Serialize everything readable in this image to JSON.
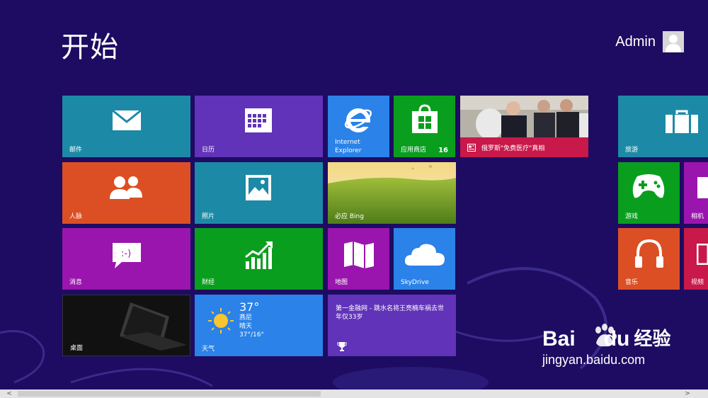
{
  "header": {
    "title": "开始",
    "user_name": "Admin"
  },
  "tiles": {
    "mail": "邮件",
    "calendar": "日历",
    "ie_line1": "Internet",
    "ie_line2": "Explorer",
    "store": "应用商店",
    "store_badge": "16",
    "news": "俄罗斯\"免费医疗\"真相",
    "travel": "旅游",
    "people": "人脉",
    "photos": "照片",
    "bing": "必应 Bing",
    "games": "游戏",
    "camera": "相机",
    "messaging": "消息",
    "finance": "财经",
    "maps": "地图",
    "skydrive": "SkyDrive",
    "music": "音乐",
    "video": "视频",
    "desktop": "桌面",
    "weather_temp": "37°",
    "weather_city": "燕尼",
    "weather_cond": "晴天",
    "weather_range": "37°/16°",
    "weather": "天气",
    "sports_headline": "第一金融网 - 跳水名将王亮楠车祸去世年仅33岁"
  },
  "scrollbar": {
    "left_arrow": "<",
    "right_arrow": ">"
  },
  "watermark": {
    "brand": "Bai",
    "brand2": "du",
    "jingyan": "经验",
    "url": "jingyan.baidu.com"
  },
  "colors": {
    "background": "#1d0c62",
    "teal": "#1c8aa6",
    "purple": "#6133b8",
    "blue": "#2b82e8",
    "green": "#0a9e1e",
    "orange": "#dc4f24",
    "magenta": "#9a15ad",
    "red": "#c9184a"
  }
}
